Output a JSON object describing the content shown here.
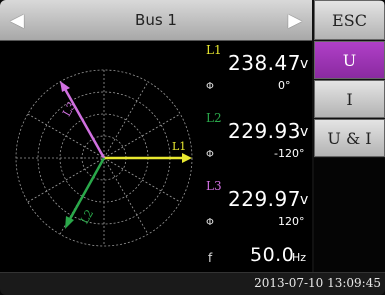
{
  "header": {
    "title": "Bus 1",
    "prev_icon": "arrow-left-icon",
    "next_icon": "arrow-right-icon"
  },
  "side_buttons": {
    "esc": "ESC",
    "u": "U",
    "i": "I",
    "ui": "U & I",
    "active_color": "#9b33b5"
  },
  "phasor": {
    "labels": {
      "l1": "L1",
      "l2": "L2",
      "l3": "L3"
    },
    "colors": {
      "l1": "#e8e830",
      "l2": "#2aa84a",
      "l3": "#d070e0"
    }
  },
  "measurements": {
    "l1": {
      "label": "L1",
      "value": "238.47",
      "unit": "v",
      "angle": "0°",
      "symbol": "Φ"
    },
    "l2": {
      "label": "L2",
      "value": "229.93",
      "unit": "v",
      "angle": "-120°",
      "symbol": "Φ"
    },
    "l3": {
      "label": "L3",
      "value": "229.97",
      "unit": "v",
      "angle": "120°",
      "symbol": "Φ"
    },
    "freq": {
      "symbol": "f",
      "value": "50.0",
      "unit": "Hz"
    }
  },
  "status": {
    "timestamp": "2013-07-10 13:09:45"
  }
}
